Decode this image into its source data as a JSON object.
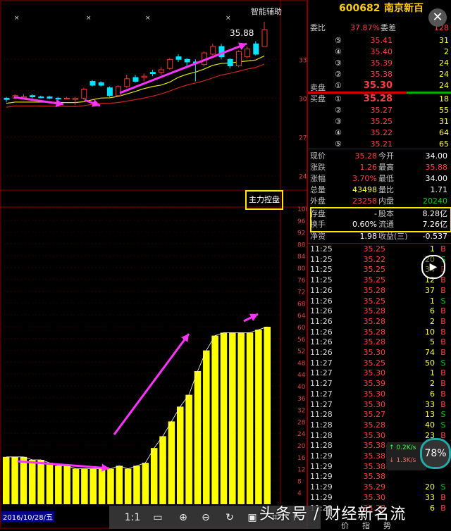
{
  "header": {
    "assist_label": "智能辅助",
    "indicator_label": "主力控盘",
    "top_price": "35.88"
  },
  "price_axis": [
    "33",
    "30",
    "27",
    "24"
  ],
  "indicator_axis": [
    "100",
    "96",
    "92",
    "88",
    "84",
    "80",
    "76",
    "72",
    "68",
    "64",
    "60",
    "56",
    "52",
    "48",
    "44",
    "40",
    "36",
    "32",
    "28",
    "24",
    "20",
    "16",
    "12",
    "8",
    "4"
  ],
  "date_label": "2016/10/28/五",
  "stock": {
    "code": "600682",
    "name": "南京新百"
  },
  "order_book": {
    "weibi_label": "委比",
    "weibi_value": "37.87%",
    "weicha_label": "委差",
    "weicha_value": "128",
    "sell_label": "卖盘",
    "buy_label": "买盘",
    "sells": [
      {
        "idx": "⑤",
        "price": "35.41",
        "vol": "31"
      },
      {
        "idx": "④",
        "price": "35.40",
        "vol": "2"
      },
      {
        "idx": "③",
        "price": "35.39",
        "vol": "24"
      },
      {
        "idx": "②",
        "price": "35.38",
        "vol": "24"
      },
      {
        "idx": "①",
        "price": "35.30",
        "vol": "24"
      }
    ],
    "buys": [
      {
        "idx": "①",
        "price": "35.28",
        "vol": "18"
      },
      {
        "idx": "②",
        "price": "35.27",
        "vol": "55"
      },
      {
        "idx": "③",
        "price": "35.25",
        "vol": "31"
      },
      {
        "idx": "④",
        "price": "35.22",
        "vol": "64"
      },
      {
        "idx": "⑤",
        "price": "35.21",
        "vol": "65"
      }
    ]
  },
  "quote": {
    "xianjia_label": "现价",
    "xianjia": "35.28",
    "jinkai_label": "今开",
    "jinkai": "34.00",
    "zhangdie_label": "涨跌",
    "zhangdie": "1.26",
    "zuigao_label": "最高",
    "zuigao": "35.88",
    "zhangfu_label": "涨幅",
    "zhangfu": "3.70%",
    "zuidi_label": "最低",
    "zuidi": "34.00",
    "zongliang_label": "总量",
    "zongliang": "43498",
    "liangbi_label": "量比",
    "liangbi": "1.71",
    "waipan_label": "外盘",
    "waipan": "23258",
    "neipan_label": "内盘",
    "neipan": "20240",
    "xingpan_label": "存盘",
    "xingpan": "-",
    "guben_label": "股本",
    "guben": "8.28亿",
    "huanshou_label": "换手",
    "huanshou": "0.60%",
    "liutong_label": "流通",
    "liutong": "7.26亿",
    "jingzi_label": "净资",
    "jingzi": "1.98",
    "shouyi_label": "收益(三)",
    "shouyi": "-0.537"
  },
  "ticks": [
    {
      "t": "11:25",
      "p": "35.25",
      "v": "1",
      "f": "B"
    },
    {
      "t": "11:25",
      "p": "35.22",
      "v": "20",
      "f": "S"
    },
    {
      "t": "11:25",
      "p": "35.25",
      "v": "34",
      "f": "B"
    },
    {
      "t": "11:25",
      "p": "35.25",
      "v": "12",
      "f": "B"
    },
    {
      "t": "11:26",
      "p": "35.28",
      "v": "37",
      "f": "B"
    },
    {
      "t": "11:26",
      "p": "35.25",
      "v": "1",
      "f": "S"
    },
    {
      "t": "11:26",
      "p": "35.28",
      "v": "6",
      "f": "B"
    },
    {
      "t": "11:26",
      "p": "35.28",
      "v": "2",
      "f": "B"
    },
    {
      "t": "11:26",
      "p": "35.28",
      "v": "10",
      "f": "B"
    },
    {
      "t": "11:26",
      "p": "35.28",
      "v": "5",
      "f": "B"
    },
    {
      "t": "11:26",
      "p": "35.30",
      "v": "74",
      "f": "B"
    },
    {
      "t": "11:27",
      "p": "35.25",
      "v": "50",
      "f": "S"
    },
    {
      "t": "11:27",
      "p": "35.30",
      "v": "1",
      "f": "B"
    },
    {
      "t": "11:27",
      "p": "35.39",
      "v": "2",
      "f": "B"
    },
    {
      "t": "11:27",
      "p": "35.30",
      "v": "6",
      "f": "B"
    },
    {
      "t": "11:27",
      "p": "35.30",
      "v": "33",
      "f": "B"
    },
    {
      "t": "11:28",
      "p": "35.27",
      "v": "13",
      "f": "S"
    },
    {
      "t": "11:28",
      "p": "35.28",
      "v": "40",
      "f": "S"
    },
    {
      "t": "11:28",
      "p": "35.30",
      "v": "23",
      "f": "B"
    },
    {
      "t": "11:28",
      "p": "35.38",
      "v": "1",
      "f": "B"
    },
    {
      "t": "11:29",
      "p": "35.38",
      "v": "",
      "f": ""
    },
    {
      "t": "11:29",
      "p": "35.38",
      "v": "",
      "f": ""
    },
    {
      "t": "11:29",
      "p": "35.38",
      "v": "",
      "f": ""
    },
    {
      "t": "11:29",
      "p": "35.29",
      "v": "20",
      "f": "S"
    },
    {
      "t": "11:29",
      "p": "35.30",
      "v": "33",
      "f": "B"
    },
    {
      "t": "11:29",
      "p": "35.28",
      "v": "6",
      "f": "B"
    }
  ],
  "speed": {
    "up": "0.2K/s",
    "down": "1.3K/s",
    "gauge": "78%"
  },
  "toolbar": {
    "ratio": "1:1"
  },
  "bottom_tabs": [
    "价",
    "指",
    "势"
  ],
  "watermark": "头条号 / 财经新名流",
  "chart_data": {
    "type": "bar",
    "title": "主力控盘",
    "bars": [
      16,
      16,
      16,
      15,
      15,
      14,
      13,
      13,
      12,
      12,
      12,
      12,
      12,
      13,
      12,
      13,
      14,
      19,
      23,
      28,
      33,
      37,
      45,
      52,
      57,
      58,
      58,
      58,
      58,
      59,
      60
    ],
    "ylim": [
      0,
      100
    ],
    "candles": [
      {
        "o": 29.9,
        "c": 30.0,
        "h": 30.1,
        "l": 29.7,
        "col": "c"
      },
      {
        "o": 30.0,
        "c": 30.2,
        "h": 30.3,
        "l": 29.9,
        "col": "r"
      },
      {
        "o": 30.1,
        "c": 30.1,
        "h": 30.3,
        "l": 30.0,
        "col": "r"
      },
      {
        "o": 30.2,
        "c": 30.1,
        "h": 30.3,
        "l": 30.0,
        "col": "c"
      },
      {
        "o": 30.1,
        "c": 30.1,
        "h": 30.2,
        "l": 30.0,
        "col": "c"
      },
      {
        "o": 30.1,
        "c": 30.0,
        "h": 30.2,
        "l": 29.9,
        "col": "c"
      },
      {
        "o": 30.0,
        "c": 30.0,
        "h": 30.1,
        "l": 29.8,
        "col": "c"
      },
      {
        "o": 30.0,
        "c": 30.0,
        "h": 30.1,
        "l": 29.9,
        "col": "r"
      },
      {
        "o": 29.9,
        "c": 30.0,
        "h": 30.1,
        "l": 29.5,
        "col": "r"
      },
      {
        "o": 30.0,
        "c": 30.7,
        "h": 30.8,
        "l": 29.9,
        "col": "r"
      },
      {
        "o": 31.0,
        "c": 31.3,
        "h": 31.4,
        "l": 30.9,
        "col": "c"
      },
      {
        "o": 31.0,
        "c": 31.2,
        "h": 31.3,
        "l": 30.9,
        "col": "c"
      },
      {
        "o": 30.8,
        "c": 30.2,
        "h": 30.9,
        "l": 30.1,
        "col": "c"
      },
      {
        "o": 30.2,
        "c": 30.9,
        "h": 31.0,
        "l": 30.1,
        "col": "r"
      },
      {
        "o": 30.9,
        "c": 31.5,
        "h": 31.8,
        "l": 30.8,
        "col": "r"
      },
      {
        "o": 31.3,
        "c": 31.6,
        "h": 31.8,
        "l": 31.2,
        "col": "c"
      },
      {
        "o": 31.6,
        "c": 31.7,
        "h": 31.9,
        "l": 31.3,
        "col": "r"
      },
      {
        "o": 31.9,
        "c": 32.0,
        "h": 32.2,
        "l": 31.7,
        "col": "c"
      },
      {
        "o": 32.0,
        "c": 32.2,
        "h": 32.4,
        "l": 31.8,
        "col": "r"
      },
      {
        "o": 32.3,
        "c": 33.0,
        "h": 33.1,
        "l": 32.2,
        "col": "r"
      },
      {
        "o": 33.0,
        "c": 33.2,
        "h": 33.4,
        "l": 32.8,
        "col": "c"
      },
      {
        "o": 33.0,
        "c": 32.8,
        "h": 33.1,
        "l": 32.5,
        "col": "c"
      },
      {
        "o": 32.8,
        "c": 32.8,
        "h": 33.0,
        "l": 31.3,
        "col": "c"
      },
      {
        "o": 32.6,
        "c": 33.5,
        "h": 33.6,
        "l": 32.5,
        "col": "r"
      },
      {
        "o": 33.4,
        "c": 34.0,
        "h": 34.2,
        "l": 33.3,
        "col": "r"
      },
      {
        "o": 34.0,
        "c": 33.2,
        "h": 34.2,
        "l": 33.0,
        "col": "c"
      },
      {
        "o": 33.0,
        "c": 32.5,
        "h": 33.1,
        "l": 32.3,
        "col": "c"
      },
      {
        "o": 32.5,
        "c": 33.6,
        "h": 33.7,
        "l": 32.4,
        "col": "r"
      },
      {
        "o": 33.2,
        "c": 33.8,
        "h": 34.0,
        "l": 33.1,
        "col": "r"
      },
      {
        "o": 34.2,
        "c": 33.4,
        "h": 34.4,
        "l": 33.3,
        "col": "c"
      },
      {
        "o": 34.0,
        "c": 35.3,
        "h": 35.9,
        "l": 34.0,
        "col": "r"
      }
    ]
  }
}
